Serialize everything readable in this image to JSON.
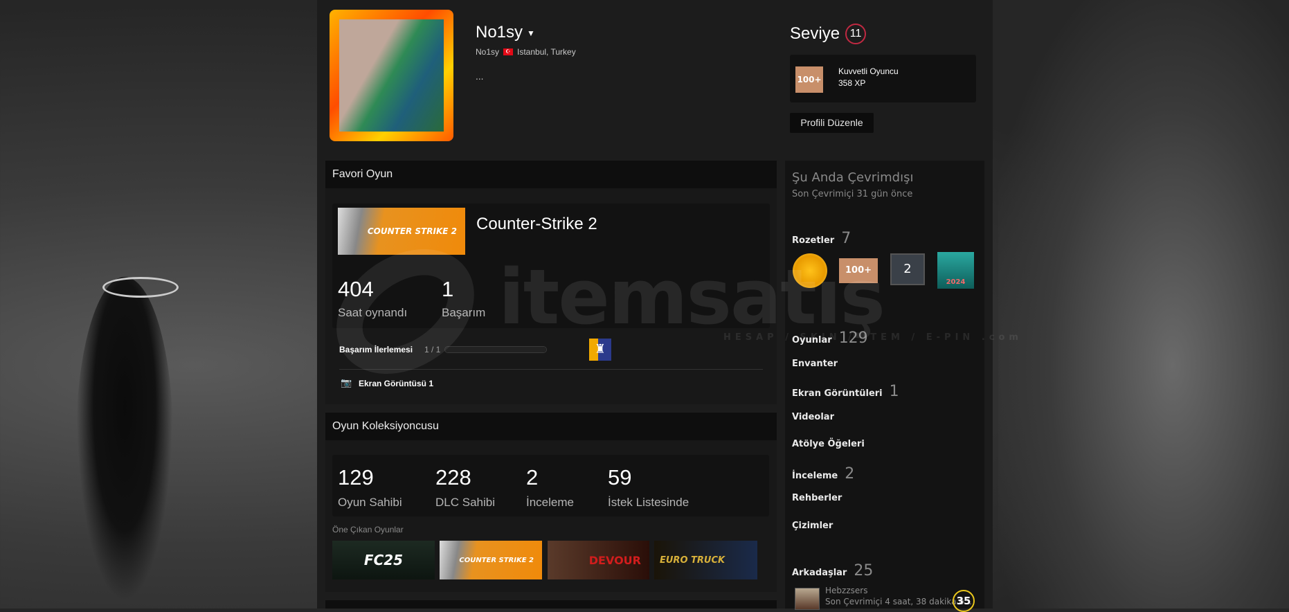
{
  "profile": {
    "name": "No1sy",
    "real_name": "No1sy",
    "location": "Istanbul, Turkey",
    "summary": "..."
  },
  "level": {
    "label": "Seviye",
    "value": "11",
    "badge_title": "Kuvvetli Oyuncu",
    "xp": "358 XP",
    "badge_text": "100+"
  },
  "edit_button": "Profili Düzenle",
  "favorite_game": {
    "header": "Favori Oyun",
    "title": "Counter-Strike 2",
    "image_text": "COUNTER STRIKE 2",
    "hours": "404",
    "hours_label": "Saat oynandı",
    "achievements": "1",
    "achievements_label": "Başarım",
    "progress_label": "Başarım İlerlemesi",
    "progress_text": "1 / 1",
    "progress_fraction": 1.0,
    "screenshot_label": "Ekran Görüntüsü 1"
  },
  "collector": {
    "header": "Oyun Koleksiyoncusu",
    "stats": [
      {
        "value": "129",
        "label": "Oyun Sahibi"
      },
      {
        "value": "228",
        "label": "DLC Sahibi"
      },
      {
        "value": "2",
        "label": "İnceleme"
      },
      {
        "value": "59",
        "label": "İstek Listesinde"
      }
    ],
    "featured_label": "Öne Çıkan Oyunlar",
    "featured": [
      {
        "name": "FC25"
      },
      {
        "name": "COUNTER STRIKE 2"
      },
      {
        "name": "DEVOUR"
      },
      {
        "name": "EURO TRUCK"
      }
    ]
  },
  "status": {
    "title": "Şu Anda Çevrimdışı",
    "last_online": "Son Çevrimiçi 31 gün önce"
  },
  "sidebar": {
    "badges_label": "Rozetler",
    "badges_count": "7",
    "badge_items": [
      "100+",
      "2",
      "2024"
    ],
    "links": [
      {
        "label": "Oyunlar",
        "count": "129"
      },
      {
        "label": "Envanter",
        "count": ""
      },
      {
        "label": "Ekran Görüntüleri",
        "count": "1"
      },
      {
        "label": "Videolar",
        "count": ""
      },
      {
        "label": "Atölye Öğeleri",
        "count": ""
      },
      {
        "label": "İnceleme",
        "count": "2"
      },
      {
        "label": "Rehberler",
        "count": ""
      },
      {
        "label": "Çizimler",
        "count": ""
      }
    ],
    "friends_label": "Arkadaşlar",
    "friends_count": "25",
    "friend": {
      "name": "Hebzzsers",
      "status": "Son Çevrimiçi 4 saat, 38 dakika ö...",
      "level": "35"
    }
  },
  "watermark": {
    "text": "itemsatış",
    "sub": "HESAP / SKIN / ITEM / E-PIN .com"
  }
}
